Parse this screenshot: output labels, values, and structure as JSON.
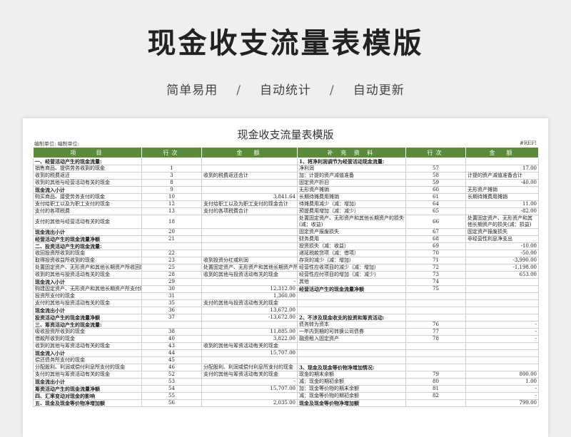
{
  "hero": {
    "title": "现金收支流量表模版",
    "tags": [
      "简单易用",
      "自动统计",
      "自动更新"
    ],
    "separator": "/"
  },
  "sheet": {
    "title": "现金收支流量表模版",
    "unit_left": "编制单位: 编制单位:",
    "unit_right": "#REF!",
    "headers": [
      "项　　目",
      "行次",
      "金　额",
      "补 充 资 料",
      "行次",
      "金　额"
    ]
  },
  "rows": [
    [
      "一、经营活动产生的现金流量:",
      "",
      "",
      "1、将净利润调节为经营活动现金流量:",
      "",
      ""
    ],
    [
      "销售商品、提供劳务收到的现金",
      "1",
      "",
      "净利润",
      "57",
      "17.00"
    ],
    [
      "收到的税费返还",
      "3",
      "收到的税费返还合计",
      "加：计提的资产减值准备",
      "58",
      "计提的资产减值准备合计"
    ],
    [
      "收到的其他与经营活动有关的现金",
      "8",
      "",
      "固定资产折旧",
      "59",
      "-40.00"
    ],
    [
      "现金流入小计",
      "9",
      "",
      "无形资产摊销",
      "60",
      "无形资产摊销"
    ],
    [
      "购买商品、接受劳务支付的现金",
      "10",
      "3,841.64",
      "长期待摊费用摊销",
      "61",
      "长期待摊费用摊销"
    ],
    [
      "支付给职工以及为职工支付的现金",
      "12",
      "支付给职工以及为职工支付的现金合计",
      "待摊费用减少（减：增加）",
      "64",
      "11.00"
    ],
    [
      "支付的各项税费",
      "13",
      "支付的各项税费合计",
      "预提费用增加（减：减少）",
      "65",
      "-82.00"
    ],
    [
      "支付的其他与经营活动有关的现金",
      "18",
      "",
      "处置固定资产、无形资产和其他长期资产的损失(减：收益)",
      "66",
      "处置固定资产、无形资产和其他长期资产的损失(减：损益)"
    ],
    [
      "现金流出小计",
      "20",
      "",
      "固定资产报废损失",
      "67",
      "固定资产报废损失"
    ],
    [
      "经营活动产生的现金流量净额",
      "21",
      "",
      "财务费用",
      "68",
      "非经营性利息净支出"
    ],
    [
      "二、投资活动产生的现金流量:",
      "",
      "",
      "投资损失（减：收益）",
      "69",
      "-10.00"
    ],
    [
      "收回投资所收到的现金",
      "22",
      "",
      "递延税款贷项（减：借项）",
      "70",
      "-50.00"
    ],
    [
      "取得投资收益所收到的现金",
      "23",
      "收到投资分红或利润",
      "存货的减少（减：增加）",
      "71",
      "-3,990.00"
    ],
    [
      "处置固定资产、无形资产和其他长期资产所收回的现金净额",
      "25",
      "处置固定资产、无形资产和其他长期资产所收回的现金净额",
      "经营性应收项目的减少（减：增加）",
      "72",
      "-1,198.00"
    ],
    [
      "收到的其他与投资活动有关的现金",
      "28",
      "收到的其他与投资活动有关的现金",
      "经营性应付项目的增加（减：减少）",
      "73",
      "653.00"
    ],
    [
      "现金流入小计",
      "29",
      "-",
      "其他",
      "74",
      ""
    ],
    [
      "购建固定资产、无形资产和其他长期资产所支付的现金",
      "30",
      "12,312.00",
      "经营活动产生的现金流量净额",
      "75",
      ""
    ],
    [
      "投资所支付的现金",
      "31",
      "1,360.00",
      "",
      "",
      ""
    ],
    [
      "支付的其他与投资活动有关的现金",
      "35",
      "支付的其他与投资活动有关的现金",
      "",
      "",
      ""
    ],
    [
      "现金流出小计",
      "36",
      "13,672.00",
      "",
      "",
      ""
    ],
    [
      "投资活动产生的现金流量净额",
      "37",
      "-13,672.00",
      "2、不涉及现金收支的投资和筹资活动:",
      "",
      ""
    ],
    [
      "三、筹资活动产生的现金流量:",
      "",
      "",
      "债务转为资本",
      "76",
      "-"
    ],
    [
      "吸收投资所收到的现金",
      "38",
      "11,885.00",
      "一年内到期的可转换公司债券",
      "77",
      "-"
    ],
    [
      "借款所收到的现金",
      "40",
      "3,822.00",
      "融资租入固定资产",
      "78",
      "-"
    ],
    [
      "收到的其他与筹资活动有关的现金",
      "43",
      "收到的其他与筹资活动有关的现金",
      "",
      "",
      ""
    ],
    [
      "现金流入小计",
      "44",
      "15,707.00",
      "",
      "",
      ""
    ],
    [
      "偿还债务所支付的现金",
      "45",
      "",
      "",
      "",
      ""
    ],
    [
      "分配股利、利润或偿付利息所支付的现金",
      "46",
      "分配股利、利润或偿付利息所支付的现金",
      "3、现金及现金等价物净增加情况:",
      "",
      ""
    ],
    [
      "支付的其他与筹资活动有关的现金",
      "52",
      "支付的其他与筹资活动有关的现金",
      "现金的期末余额",
      "79",
      "800.00"
    ],
    [
      "现金流出小计",
      "53",
      "-",
      "减：现金的期初余额",
      "80",
      "1.00"
    ],
    [
      "筹资活动产生的现金流量净额",
      "54",
      "15,707.00",
      "加：现金等价物的期末余额",
      "81",
      "-"
    ],
    [
      "四、汇率变动对现金的影响",
      "55",
      "",
      "减：现金等价物的期初余额",
      "82",
      "-"
    ],
    [
      "五、现金及现金等价物净增加额",
      "56",
      "2,035.00",
      "现金及现金等价物净增加额",
      "",
      "799.00"
    ]
  ]
}
